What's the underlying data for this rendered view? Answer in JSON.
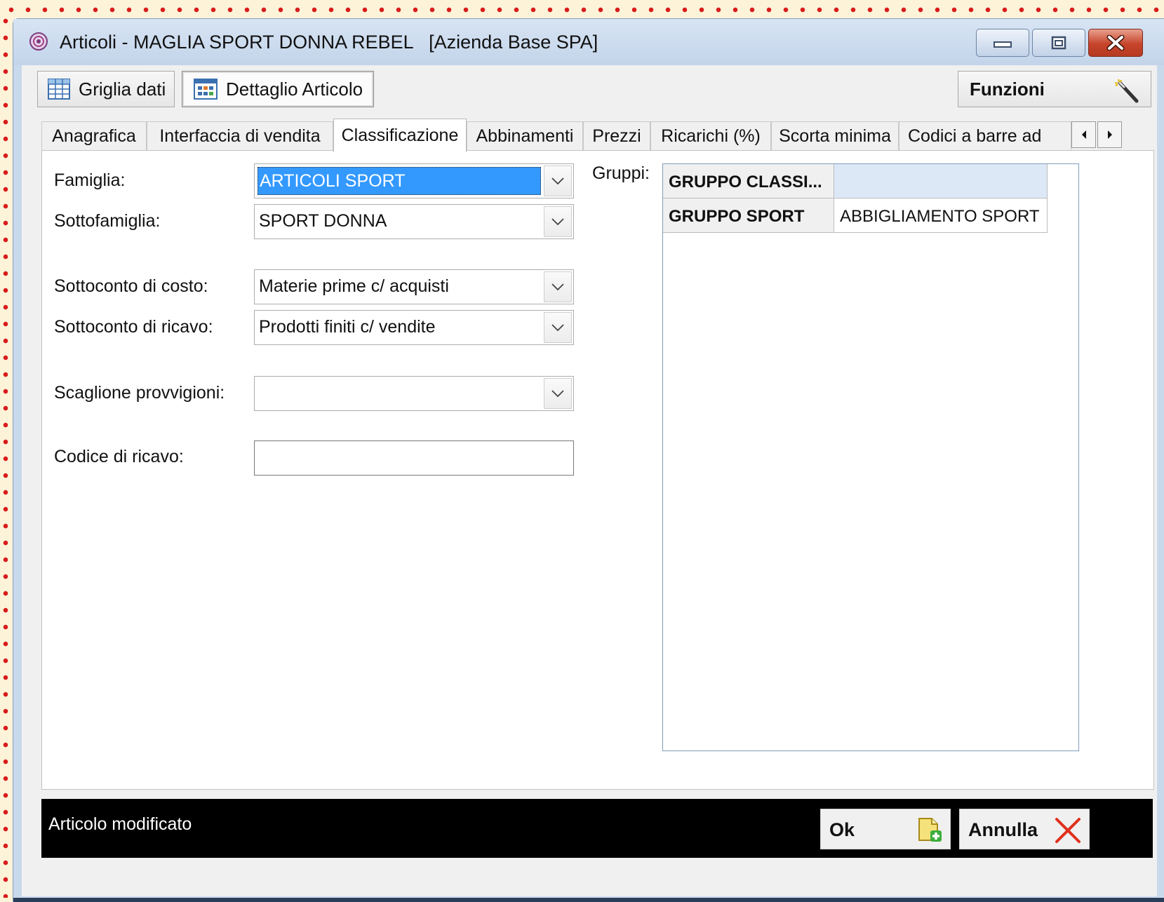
{
  "window": {
    "title": "Articoli - MAGLIA SPORT DONNA REBEL   [Azienda Base SPA]"
  },
  "toolbar": {
    "griglia_label": "Griglia dati",
    "dettaglio_label": "Dettaglio Articolo",
    "funzioni_label": "Funzioni"
  },
  "tabs": [
    {
      "label": "Anagrafica"
    },
    {
      "label": "Interfaccia di vendita"
    },
    {
      "label": "Classificazione",
      "active": true
    },
    {
      "label": "Abbinamenti"
    },
    {
      "label": "Prezzi"
    },
    {
      "label": "Ricarichi (%)"
    },
    {
      "label": "Scorta minima"
    },
    {
      "label": "Codici a barre ad"
    }
  ],
  "form": {
    "famiglia": {
      "label": "Famiglia:",
      "value": "ARTICOLI SPORT"
    },
    "sottofamiglia": {
      "label": "Sottofamiglia:",
      "value": "SPORT DONNA"
    },
    "sottoconto_costo": {
      "label": "Sottoconto di costo:",
      "value": "Materie prime c/ acquisti"
    },
    "sottoconto_ricavo": {
      "label": "Sottoconto di ricavo:",
      "value": "Prodotti finiti c/ vendite"
    },
    "scaglione": {
      "label": "Scaglione provvigioni:",
      "value": ""
    },
    "codice_ricavo": {
      "label": "Codice di ricavo:",
      "value": ""
    }
  },
  "gruppi": {
    "label": "Gruppi:",
    "rows": [
      {
        "name": "GRUPPO CLASSI...",
        "value": ""
      },
      {
        "name": "GRUPPO SPORT",
        "value": "ABBIGLIAMENTO SPORT"
      }
    ]
  },
  "status": {
    "text": "Articolo modificato",
    "ok_label": "Ok",
    "annulla_label": "Annulla"
  },
  "colors": {
    "selection": "#3399ff",
    "status_bg": "#000000",
    "close_button": "#c6442a"
  }
}
